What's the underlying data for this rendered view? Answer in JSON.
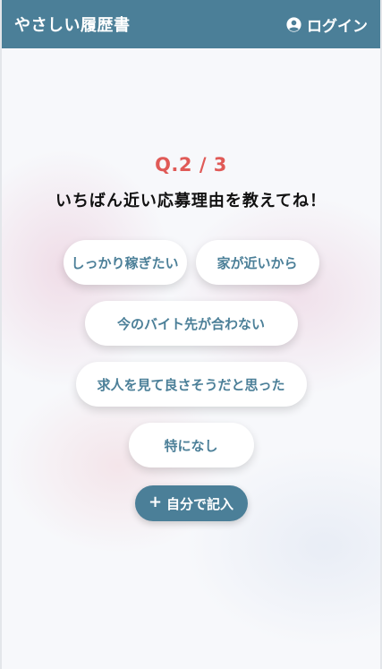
{
  "header": {
    "brand": "やさしい履歴書",
    "login_label": "ログイン",
    "login_icon": "user-circle-icon"
  },
  "question": {
    "number_label": "Q.2 / 3",
    "text": "いちばん近い応募理由を教えてね！"
  },
  "choices": [
    {
      "label": "しっかり稼ぎたい"
    },
    {
      "label": "家が近いから"
    },
    {
      "label": "今のバイト先が合わない"
    },
    {
      "label": "求人を見て良さそうだと思った"
    },
    {
      "label": "特になし"
    }
  ],
  "self_entry": {
    "icon": "plus-icon",
    "label": "自分で記入"
  },
  "colors": {
    "primary": "#4b7f98",
    "accent": "#e05a57",
    "text": "#111111",
    "button_bg": "#ffffff"
  }
}
